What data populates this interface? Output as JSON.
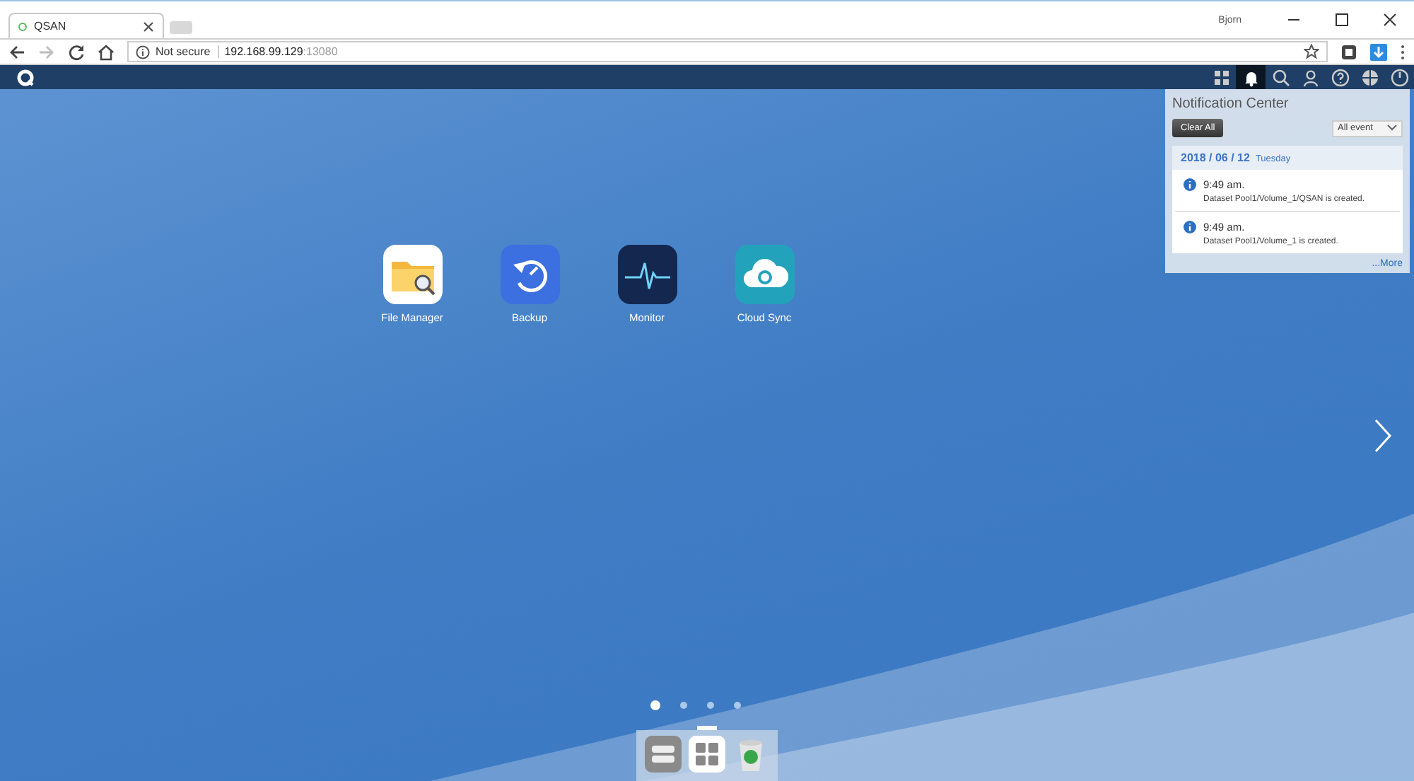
{
  "browser": {
    "tab": {
      "title": "QSAN"
    },
    "profile": "Bjorn",
    "address": {
      "security": "Not secure",
      "host": "192.168.99.129",
      "port": ":13080"
    }
  },
  "topbar": {
    "tools": [
      {
        "kind": "apps",
        "selected": false
      },
      {
        "kind": "bell",
        "selected": true
      },
      {
        "kind": "search",
        "selected": false
      },
      {
        "kind": "user",
        "selected": false
      },
      {
        "kind": "help",
        "selected": false
      },
      {
        "kind": "globe",
        "selected": false
      },
      {
        "kind": "gauge",
        "selected": false
      }
    ]
  },
  "apps": [
    {
      "kind": "files",
      "label": "File Manager"
    },
    {
      "kind": "backup",
      "label": "Backup"
    },
    {
      "kind": "monitor",
      "label": "Monitor"
    },
    {
      "kind": "cloud",
      "label": "Cloud Sync"
    }
  ],
  "notification_center": {
    "title": "Notification Center",
    "clear_button": "Clear All",
    "filter": "All event",
    "date": "2018 / 06 / 12",
    "weekday": "Tuesday",
    "items": [
      {
        "time": "9:49 am.",
        "message": "Dataset Pool1/Volume_1/QSAN is created."
      },
      {
        "time": "9:49 am.",
        "message": "Dataset Pool1/Volume_1 is created."
      }
    ],
    "more_link": "...More"
  },
  "pages": [
    {
      "selected": true
    },
    {
      "selected": false
    },
    {
      "selected": false
    },
    {
      "selected": false
    }
  ],
  "dock": [
    {
      "kind": "storage",
      "selected": false
    },
    {
      "kind": "apps",
      "selected": true
    },
    {
      "kind": "recycle",
      "selected": false
    }
  ]
}
